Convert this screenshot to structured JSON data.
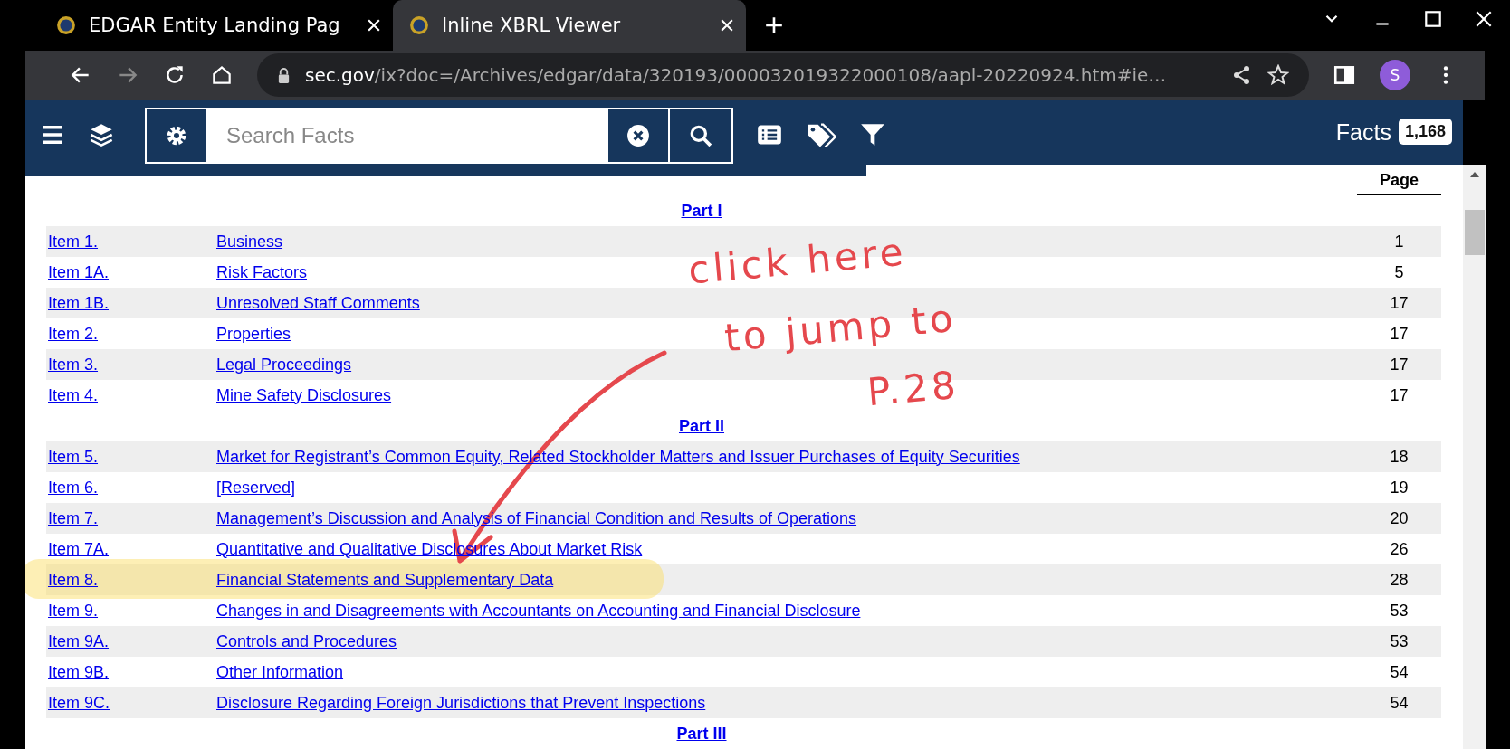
{
  "browser": {
    "tabs": [
      {
        "title": "EDGAR Entity Landing Pag",
        "selected": false
      },
      {
        "title": "Inline XBRL Viewer",
        "selected": true
      }
    ],
    "url": {
      "domain": "sec.gov",
      "path": "/ix?doc=/Archives/edgar/data/320193/000032019322000108/aapl-20220924.htm#ie…"
    },
    "profile_initial": "S"
  },
  "toolbar": {
    "search": {
      "placeholder": "Search Facts"
    },
    "facts_label": "Facts",
    "facts_count": "1,168"
  },
  "toc": {
    "page_header": "Page",
    "sections": [
      {
        "title": "Part I",
        "rows": [
          {
            "item": "Item 1.",
            "title": "Business",
            "page": "1",
            "highlighted": false
          },
          {
            "item": "Item 1A.",
            "title": "Risk Factors",
            "page": "5",
            "highlighted": false
          },
          {
            "item": "Item 1B.",
            "title": "Unresolved Staff Comments",
            "page": "17",
            "highlighted": false
          },
          {
            "item": "Item 2.",
            "title": "Properties",
            "page": "17",
            "highlighted": false
          },
          {
            "item": "Item 3.",
            "title": "Legal Proceedings",
            "page": "17",
            "highlighted": false
          },
          {
            "item": "Item 4.",
            "title": "Mine Safety Disclosures",
            "page": "17",
            "highlighted": false
          }
        ]
      },
      {
        "title": "Part II",
        "rows": [
          {
            "item": "Item 5.",
            "title": "Market for Registrant’s Common Equity, Related Stockholder Matters and Issuer Purchases of Equity Securities",
            "page": "18",
            "highlighted": false
          },
          {
            "item": "Item 6.",
            "title": "[Reserved]",
            "page": "19",
            "highlighted": false
          },
          {
            "item": "Item 7.",
            "title": "Management’s Discussion and Analysis of Financial Condition and Results of Operations",
            "page": "20",
            "highlighted": false
          },
          {
            "item": "Item 7A.",
            "title": "Quantitative and Qualitative Disclosures About Market Risk",
            "page": "26",
            "highlighted": false
          },
          {
            "item": "Item 8.",
            "title": "Financial Statements and Supplementary Data",
            "page": "28",
            "highlighted": true
          },
          {
            "item": "Item 9.",
            "title": "Changes in and Disagreements with Accountants on Accounting and Financial Disclosure",
            "page": "53",
            "highlighted": false
          },
          {
            "item": "Item 9A.",
            "title": "Controls and Procedures",
            "page": "53",
            "highlighted": false
          },
          {
            "item": "Item 9B.",
            "title": "Other Information",
            "page": "54",
            "highlighted": false
          },
          {
            "item": "Item 9C.",
            "title": "Disclosure Regarding Foreign Jurisdictions that Prevent Inspections",
            "page": "54",
            "highlighted": false
          }
        ]
      },
      {
        "title": "Part III"
      }
    ]
  },
  "annotation": {
    "lines": [
      "click here",
      "to jump to",
      "P.28"
    ]
  }
}
